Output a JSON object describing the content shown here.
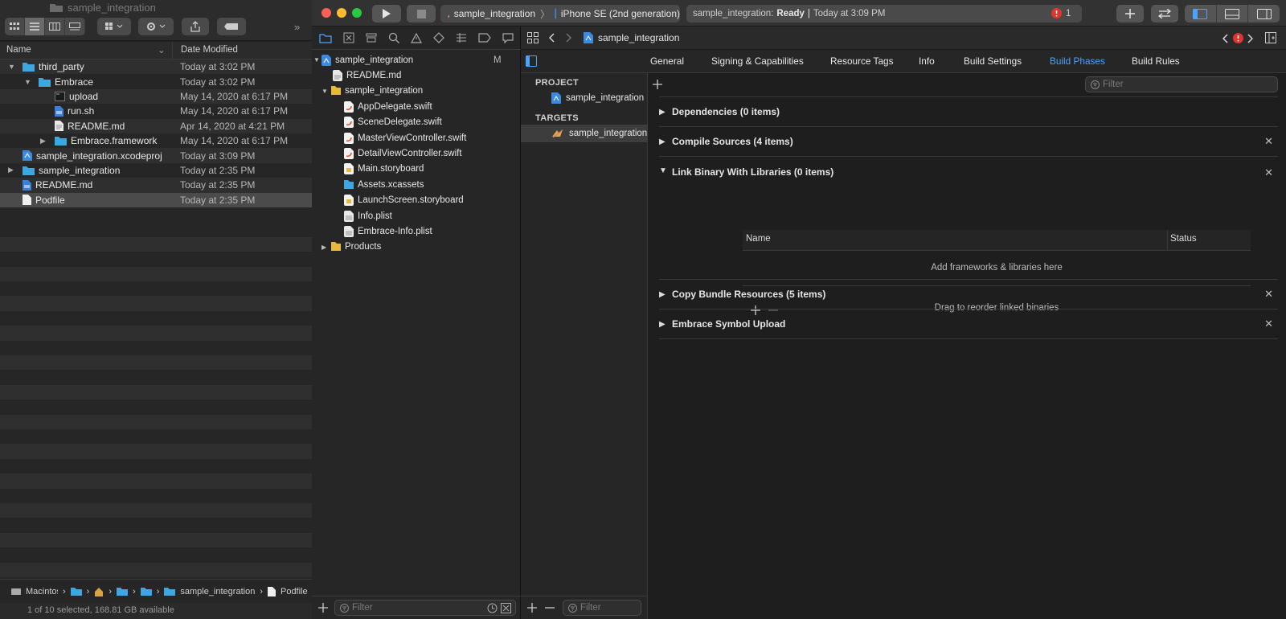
{
  "finder": {
    "window_title": "sample_integration",
    "columns": {
      "name": "Name",
      "date": "Date Modified"
    },
    "rows": [
      {
        "name": "third_party",
        "date": "Today at 3:02 PM"
      },
      {
        "name": "Embrace",
        "date": "Today at 3:02 PM"
      },
      {
        "name": "upload",
        "date": "May 14, 2020 at 6:17 PM"
      },
      {
        "name": "run.sh",
        "date": "May 14, 2020 at 6:17 PM"
      },
      {
        "name": "README.md",
        "date": "Apr 14, 2020 at 4:21 PM"
      },
      {
        "name": "Embrace.framework",
        "date": "May 14, 2020 at 6:17 PM"
      },
      {
        "name": "sample_integration.xcodeproj",
        "date": "Today at 3:09 PM"
      },
      {
        "name": "sample_integration",
        "date": "Today at 2:35 PM"
      },
      {
        "name": "README.md",
        "date": "Today at 2:35 PM"
      },
      {
        "name": "Podfile",
        "date": "Today at 2:35 PM"
      }
    ],
    "path_bar": {
      "first": "Macintosh",
      "folder": "sample_integration",
      "last": "Podfile"
    },
    "status": "1 of 10 selected, 168.81 GB available"
  },
  "xcode": {
    "scheme": {
      "target": "sample_integration",
      "device": "iPhone SE (2nd generation)"
    },
    "activity": {
      "project": "sample_integration:",
      "state": "Ready",
      "sep": "|",
      "time": "Today at 3:09 PM",
      "error_count": "1"
    },
    "navigator": {
      "items": [
        {
          "label": "sample_integration",
          "badge": "M"
        },
        {
          "label": "README.md"
        },
        {
          "label": "sample_integration"
        },
        {
          "label": "AppDelegate.swift"
        },
        {
          "label": "SceneDelegate.swift"
        },
        {
          "label": "MasterViewController.swift"
        },
        {
          "label": "DetailViewController.swift"
        },
        {
          "label": "Main.storyboard"
        },
        {
          "label": "Assets.xcassets"
        },
        {
          "label": "LaunchScreen.storyboard"
        },
        {
          "label": "Info.plist"
        },
        {
          "label": "Embrace-Info.plist"
        },
        {
          "label": "Products"
        }
      ],
      "filter_placeholder": "Filter"
    },
    "jump_bar": {
      "label": "sample_integration"
    },
    "tabs": [
      "General",
      "Signing & Capabilities",
      "Resource Tags",
      "Info",
      "Build Settings",
      "Build Phases",
      "Build Rules"
    ],
    "active_tab": "Build Phases",
    "project_header": "PROJECT",
    "project_item": "sample_integration",
    "targets_header": "TARGETS",
    "target_item": "sample_integration",
    "targets_filter_placeholder": "Filter",
    "phases_filter_placeholder": "Filter",
    "phases": [
      {
        "label": "Dependencies (0 items)",
        "expanded": false
      },
      {
        "label": "Compile Sources (4 items)",
        "expanded": false
      },
      {
        "label": "Link Binary With Libraries (0 items)",
        "expanded": true
      },
      {
        "label": "Copy Bundle Resources (5 items)",
        "expanded": false
      },
      {
        "label": "Embrace Symbol Upload",
        "expanded": false
      }
    ],
    "lib_table": {
      "col_name": "Name",
      "col_status": "Status",
      "empty": "Add frameworks & libraries here",
      "reorder": "Drag to reorder linked binaries"
    }
  },
  "colors": {
    "accent": "#4aa3ff",
    "folder": "#3fa7e0",
    "error": "#e0342f"
  }
}
